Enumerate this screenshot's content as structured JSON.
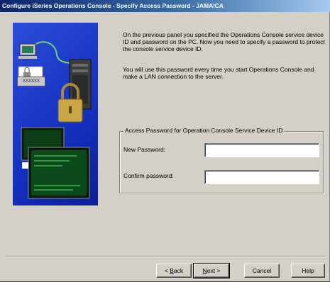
{
  "window": {
    "title": "Configure iSeries Operations Console - Specify Access Password - JAMAICA"
  },
  "intro": {
    "paragraph1": "On the previous panel you specified the Operations Console service device ID and password on the PC.  Now you need to specify a password to protect the console service device ID.",
    "paragraph2": "You will use this password every time you start Operations Console and make a LAN connection to the server."
  },
  "group": {
    "legend": "Access Password for Operation Console Service Device ID",
    "new_password_label": "New Password:",
    "new_password_value": "",
    "confirm_password_label": "Confirm password:",
    "confirm_password_value": ""
  },
  "illustration": {
    "badge_text": "XXXXXX",
    "colors": {
      "panel_blue": "#1f3fd0",
      "screen_green": "#2fae3a",
      "lock_gold": "#c9a646"
    }
  },
  "buttons": {
    "back": {
      "mnemonic": "B",
      "rest": "ack",
      "prefix": "< "
    },
    "next": {
      "mnemonic": "N",
      "rest": "ext >",
      "prefix": ""
    },
    "cancel": "Cancel",
    "help": "Help"
  }
}
